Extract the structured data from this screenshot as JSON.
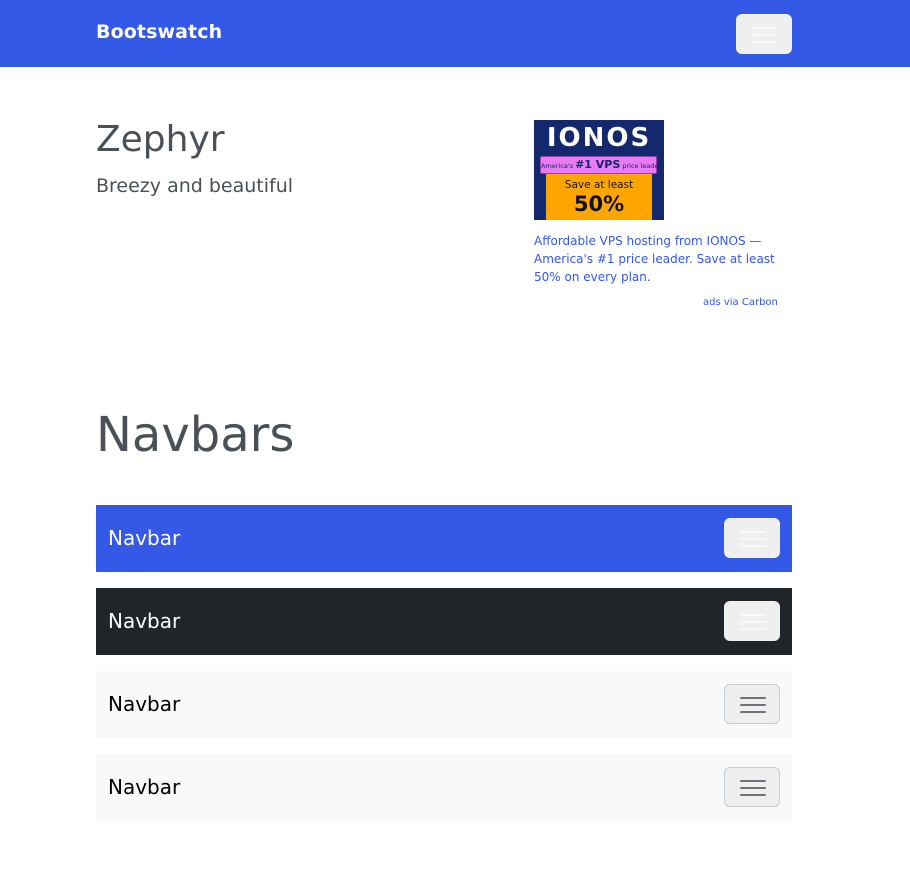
{
  "topnav": {
    "brand": "Bootswatch",
    "toggler_icon": "hamburger-icon"
  },
  "header": {
    "title": "Zephyr",
    "subtitle": "Breezy and beautiful"
  },
  "ad": {
    "logo_text": "IONOS",
    "pill_prefix": "America's",
    "pill_highlight": "#1 VPS",
    "pill_suffix": "price leader",
    "offer_line": "Save at least",
    "offer_value": "50%",
    "text": "Affordable VPS hosting from IONOS — America's #1 price leader. Save at least 50% on every plan.",
    "via": "ads via Carbon"
  },
  "navbars": {
    "section_title": "Navbars",
    "items": [
      {
        "brand": "Navbar",
        "variant": "primary",
        "bg": "#3459e6"
      },
      {
        "brand": "Navbar",
        "variant": "dark",
        "bg": "#212529"
      },
      {
        "brand": "Navbar",
        "variant": "light",
        "bg": "#f8f9fa"
      },
      {
        "brand": "Navbar",
        "variant": "light",
        "bg": "#f8f9fa"
      }
    ]
  },
  "colors": {
    "primary": "#3459e6",
    "dark": "#212529",
    "light": "#f8f9fa",
    "body_text": "#495057"
  }
}
